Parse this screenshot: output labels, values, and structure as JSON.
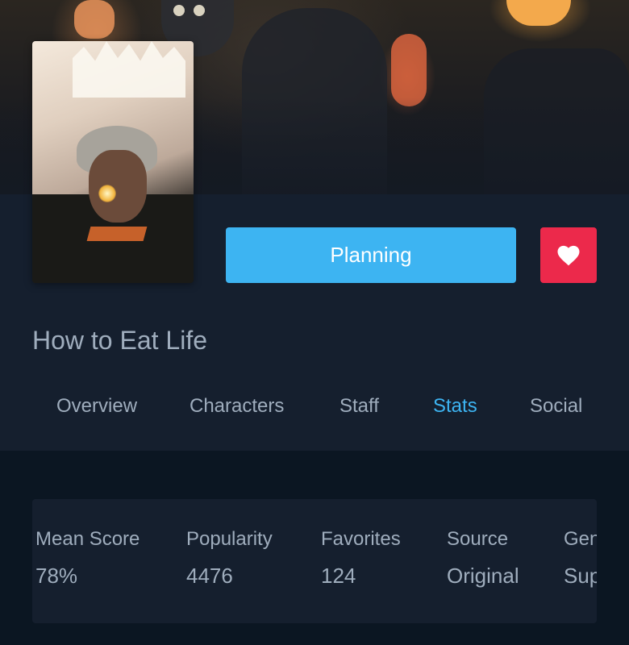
{
  "media": {
    "title": "How to Eat Life",
    "status_button_label": "Planning",
    "favorite_icon": "heart-icon"
  },
  "tabs": [
    {
      "label": "Overview",
      "active": false
    },
    {
      "label": "Characters",
      "active": false
    },
    {
      "label": "Staff",
      "active": false
    },
    {
      "label": "Stats",
      "active": true
    },
    {
      "label": "Social",
      "active": false
    }
  ],
  "stats": [
    {
      "label": "Mean Score",
      "value": "78%"
    },
    {
      "label": "Popularity",
      "value": "4476"
    },
    {
      "label": "Favorites",
      "value": "124"
    },
    {
      "label": "Source",
      "value": "Original"
    },
    {
      "label": "Gen",
      "value": "Sup"
    }
  ],
  "colors": {
    "accent": "#3db4f2",
    "favorite": "#ec294b",
    "background": "#0b1622",
    "surface": "#151f2e",
    "text": "#9fadbd"
  }
}
